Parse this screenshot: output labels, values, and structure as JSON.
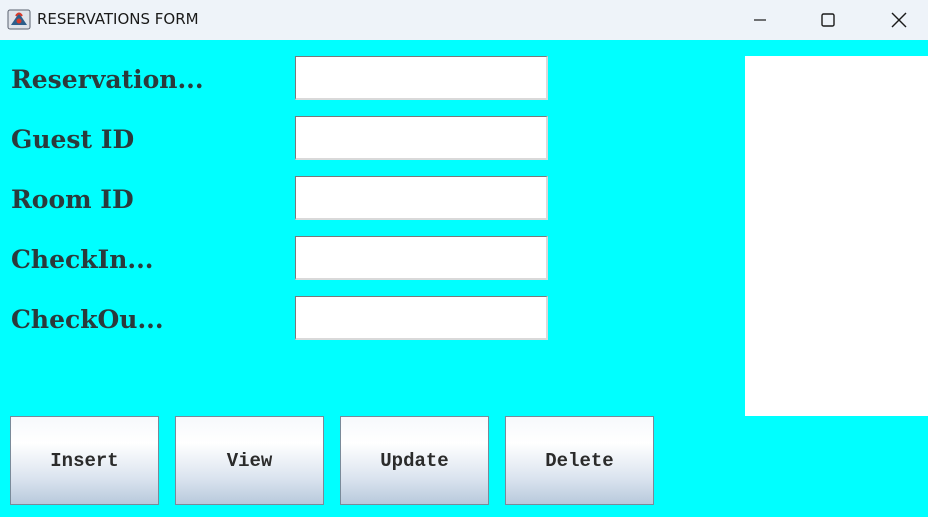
{
  "window": {
    "title": "RESERVATIONS FORM",
    "icon": "java-app-icon",
    "controls": {
      "minimize_icon": "minimize-icon",
      "maximize_icon": "maximize-icon",
      "close_icon": "close-icon"
    }
  },
  "form": {
    "fields": [
      {
        "label": "Reservation...",
        "value": ""
      },
      {
        "label": "Guest ID",
        "value": ""
      },
      {
        "label": "Room ID",
        "value": ""
      },
      {
        "label": "CheckIn...",
        "value": ""
      },
      {
        "label": "CheckOu...",
        "value": ""
      }
    ]
  },
  "buttons": {
    "insert": "Insert",
    "view": "View",
    "update": "Update",
    "delete": "Delete"
  },
  "colors": {
    "background": "#00ffff",
    "titlebar": "#eef3f9",
    "label_text": "#2b3a3c"
  }
}
